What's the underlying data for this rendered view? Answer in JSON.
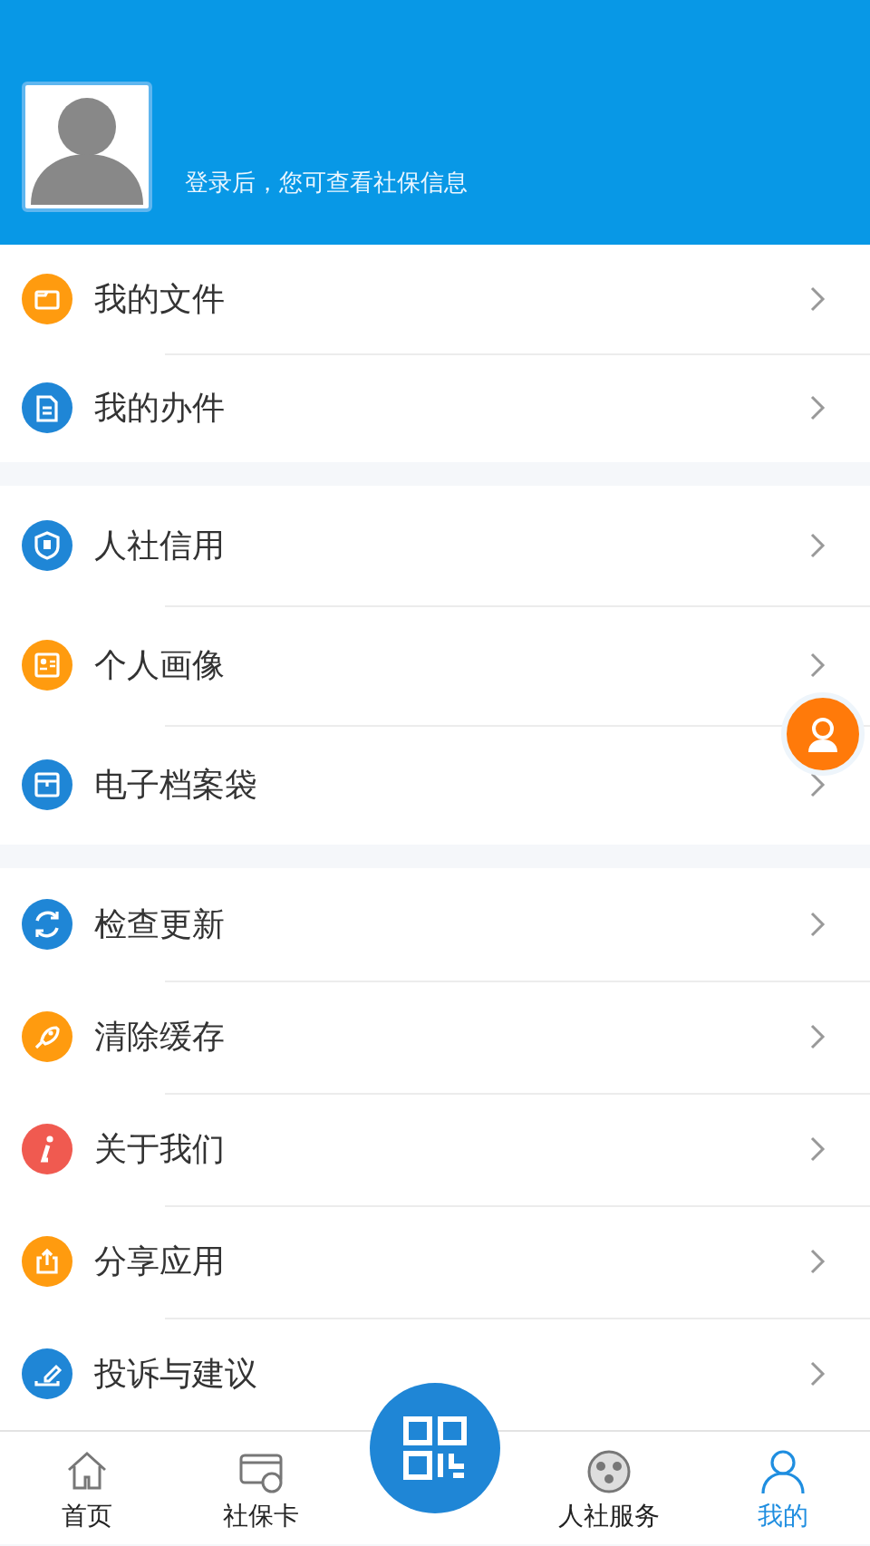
{
  "header": {
    "login_hint": "登录后，您可查看社保信息"
  },
  "groups": [
    {
      "items": [
        {
          "label": "我的文件",
          "color": "#ff9b0f"
        },
        {
          "label": "我的办件",
          "color": "#1f86d6"
        }
      ]
    },
    {
      "items": [
        {
          "label": "人社信用",
          "color": "#1f86d6"
        },
        {
          "label": "个人画像",
          "color": "#ff9b0f"
        },
        {
          "label": "电子档案袋",
          "color": "#1f86d6"
        }
      ]
    },
    {
      "items": [
        {
          "label": "检查更新",
          "color": "#1f86d6"
        },
        {
          "label": "清除缓存",
          "color": "#ff9b0f"
        },
        {
          "label": "关于我们",
          "color": "#f05a50"
        },
        {
          "label": "分享应用",
          "color": "#ff9b0f"
        },
        {
          "label": "投诉与建议",
          "color": "#1f86d6"
        }
      ]
    }
  ],
  "bottom_nav": [
    {
      "label": "首页",
      "selected": false
    },
    {
      "label": "社保卡",
      "selected": false
    },
    {
      "label": "人社服务",
      "selected": false
    },
    {
      "label": "我的",
      "selected": true
    }
  ]
}
